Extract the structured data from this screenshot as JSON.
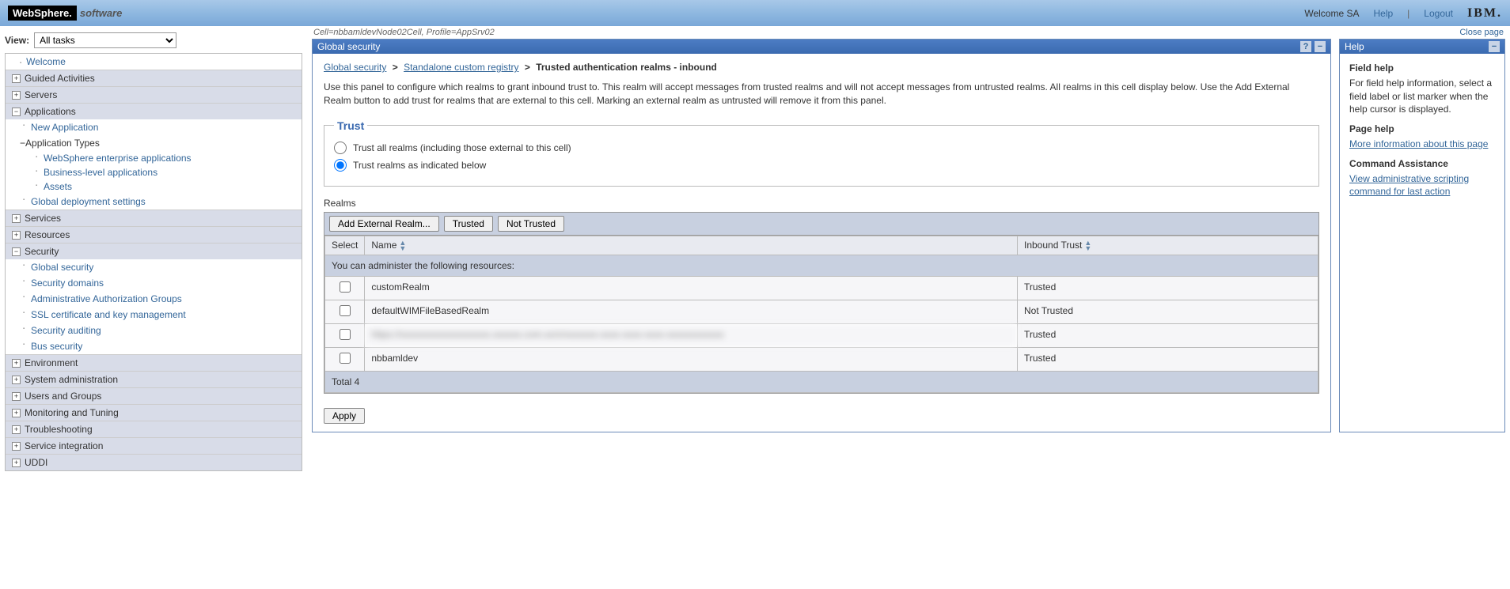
{
  "banner": {
    "brand_ws": "WebSphere.",
    "brand_sw": "software",
    "welcome": "Welcome SA",
    "help": "Help",
    "logout": "Logout",
    "ibm": "IBM."
  },
  "view": {
    "label": "View:",
    "selected": "All tasks"
  },
  "nav": {
    "welcome": "Welcome",
    "guided": "Guided Activities",
    "servers": "Servers",
    "applications": "Applications",
    "new_app": "New Application",
    "app_types": "Application Types",
    "ws_apps": "WebSphere enterprise applications",
    "biz_apps": "Business-level applications",
    "assets": "Assets",
    "global_deploy": "Global deployment settings",
    "services": "Services",
    "resources": "Resources",
    "security": "Security",
    "global_security": "Global security",
    "security_domains": "Security domains",
    "admin_auth": "Administrative Authorization Groups",
    "ssl": "SSL certificate and key management",
    "sec_audit": "Security auditing",
    "bus_security": "Bus security",
    "environment": "Environment",
    "sys_admin": "System administration",
    "users_groups": "Users and Groups",
    "monitoring": "Monitoring and Tuning",
    "troubleshooting": "Troubleshooting",
    "service_integration": "Service integration",
    "uddi": "UDDI"
  },
  "cell_info": "Cell=nbbamldevNode02Cell, Profile=AppSrv02",
  "close_page": "Close page",
  "main": {
    "portlet_title": "Global security",
    "crumb1": "Global security",
    "crumb2": "Standalone custom registry",
    "crumb3": "Trusted authentication realms - inbound",
    "desc": "Use this panel to configure which realms to grant inbound trust to. This realm will accept messages from trusted realms and will not accept messages from untrusted realms. All realms in this cell display below. Use the Add External Realm button to add trust for realms that are external to this cell. Marking an external realm as untrusted will remove it from this panel.",
    "trust_legend": "Trust",
    "trust_all": "Trust all realms (including those external to this cell)",
    "trust_below": "Trust realms as indicated below",
    "realms_label": "Realms",
    "btn_add": "Add External Realm...",
    "btn_trusted": "Trusted",
    "btn_not_trusted": "Not Trusted",
    "col_select": "Select",
    "col_name": "Name",
    "col_inbound": "Inbound Trust",
    "admin_row": "You can administer the following resources:",
    "rows": [
      {
        "name": "customRealm",
        "trust": "Trusted",
        "blurred": false
      },
      {
        "name": "defaultWIMFileBasedRealm",
        "trust": "Not Trusted",
        "blurred": false
      },
      {
        "name": "https://xxxxxxxxxxxxxxxxxxx.xxxxxx.com.xx/x/xxxxxxx-xxxx-xxxx-xxxx-xxxxxxxxxxxx",
        "trust": "Trusted",
        "blurred": true
      },
      {
        "name": "nbbamldev",
        "trust": "Trusted",
        "blurred": false
      }
    ],
    "total": "Total 4",
    "apply": "Apply"
  },
  "help": {
    "title": "Help",
    "field_help_h": "Field help",
    "field_help_t": "For field help information, select a field label or list marker when the help cursor is displayed.",
    "page_help_h": "Page help",
    "page_help_link": "More information about this page",
    "cmd_h": "Command Assistance",
    "cmd_link": "View administrative scripting command for last action"
  }
}
